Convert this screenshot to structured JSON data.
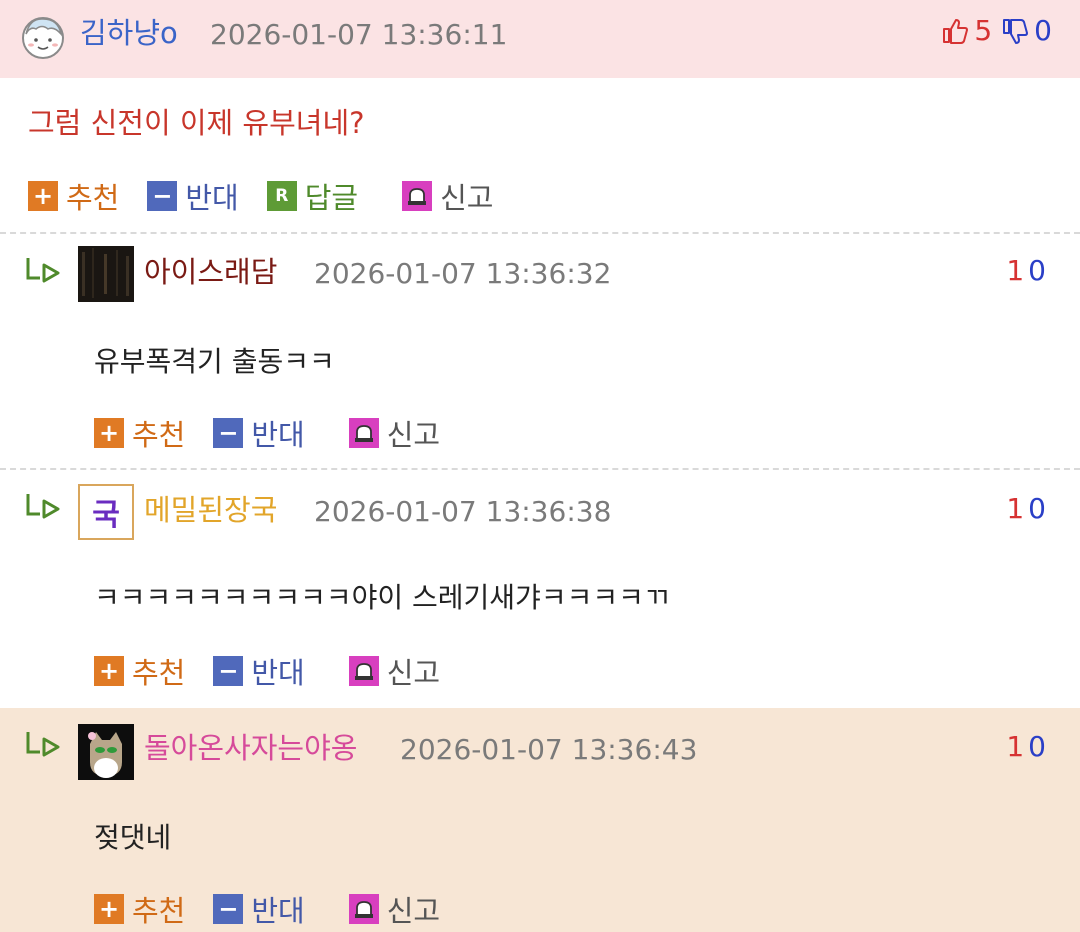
{
  "main_comment": {
    "nickname": "김하냥o",
    "date": "2026-01-07 13:36:11",
    "up_votes": "5",
    "down_votes": "0",
    "body": "그럼 신전이 이제 유부녀네?"
  },
  "actions": {
    "recommend": "추천",
    "oppose": "반대",
    "reply": "답글",
    "report": "신고",
    "reply_badge": "R"
  },
  "replies": [
    {
      "nickname": "아이스래담",
      "nickname_color": "#7a1a14",
      "date": "2026-01-07 13:36:32",
      "up_votes": "1",
      "down_votes": "0",
      "body": "유부폭격기 출동ㅋㅋ"
    },
    {
      "nickname": "메밀된장국",
      "nickname_color": "#e2a52a",
      "date": "2026-01-07 13:36:38",
      "up_votes": "1",
      "down_votes": "0",
      "body": "ㅋㅋㅋㅋㅋㅋㅋㅋㅋㅋ야이 스레기새갸ㅋㅋㅋㅋㄲ",
      "avatar_glyph": "국"
    },
    {
      "nickname": "돌아온사자는야옹",
      "nickname_color": "#d64a9a",
      "date": "2026-01-07 13:36:43",
      "up_votes": "1",
      "down_votes": "0",
      "body": "젖댓네"
    }
  ],
  "colors": {
    "main_header_bg": "#fbe3e4",
    "highlight_bg": "#f7e6d5",
    "recommend": "#e07a24",
    "oppose": "#5069bb",
    "reply": "#5e9b36",
    "report": "#d83fbf"
  }
}
